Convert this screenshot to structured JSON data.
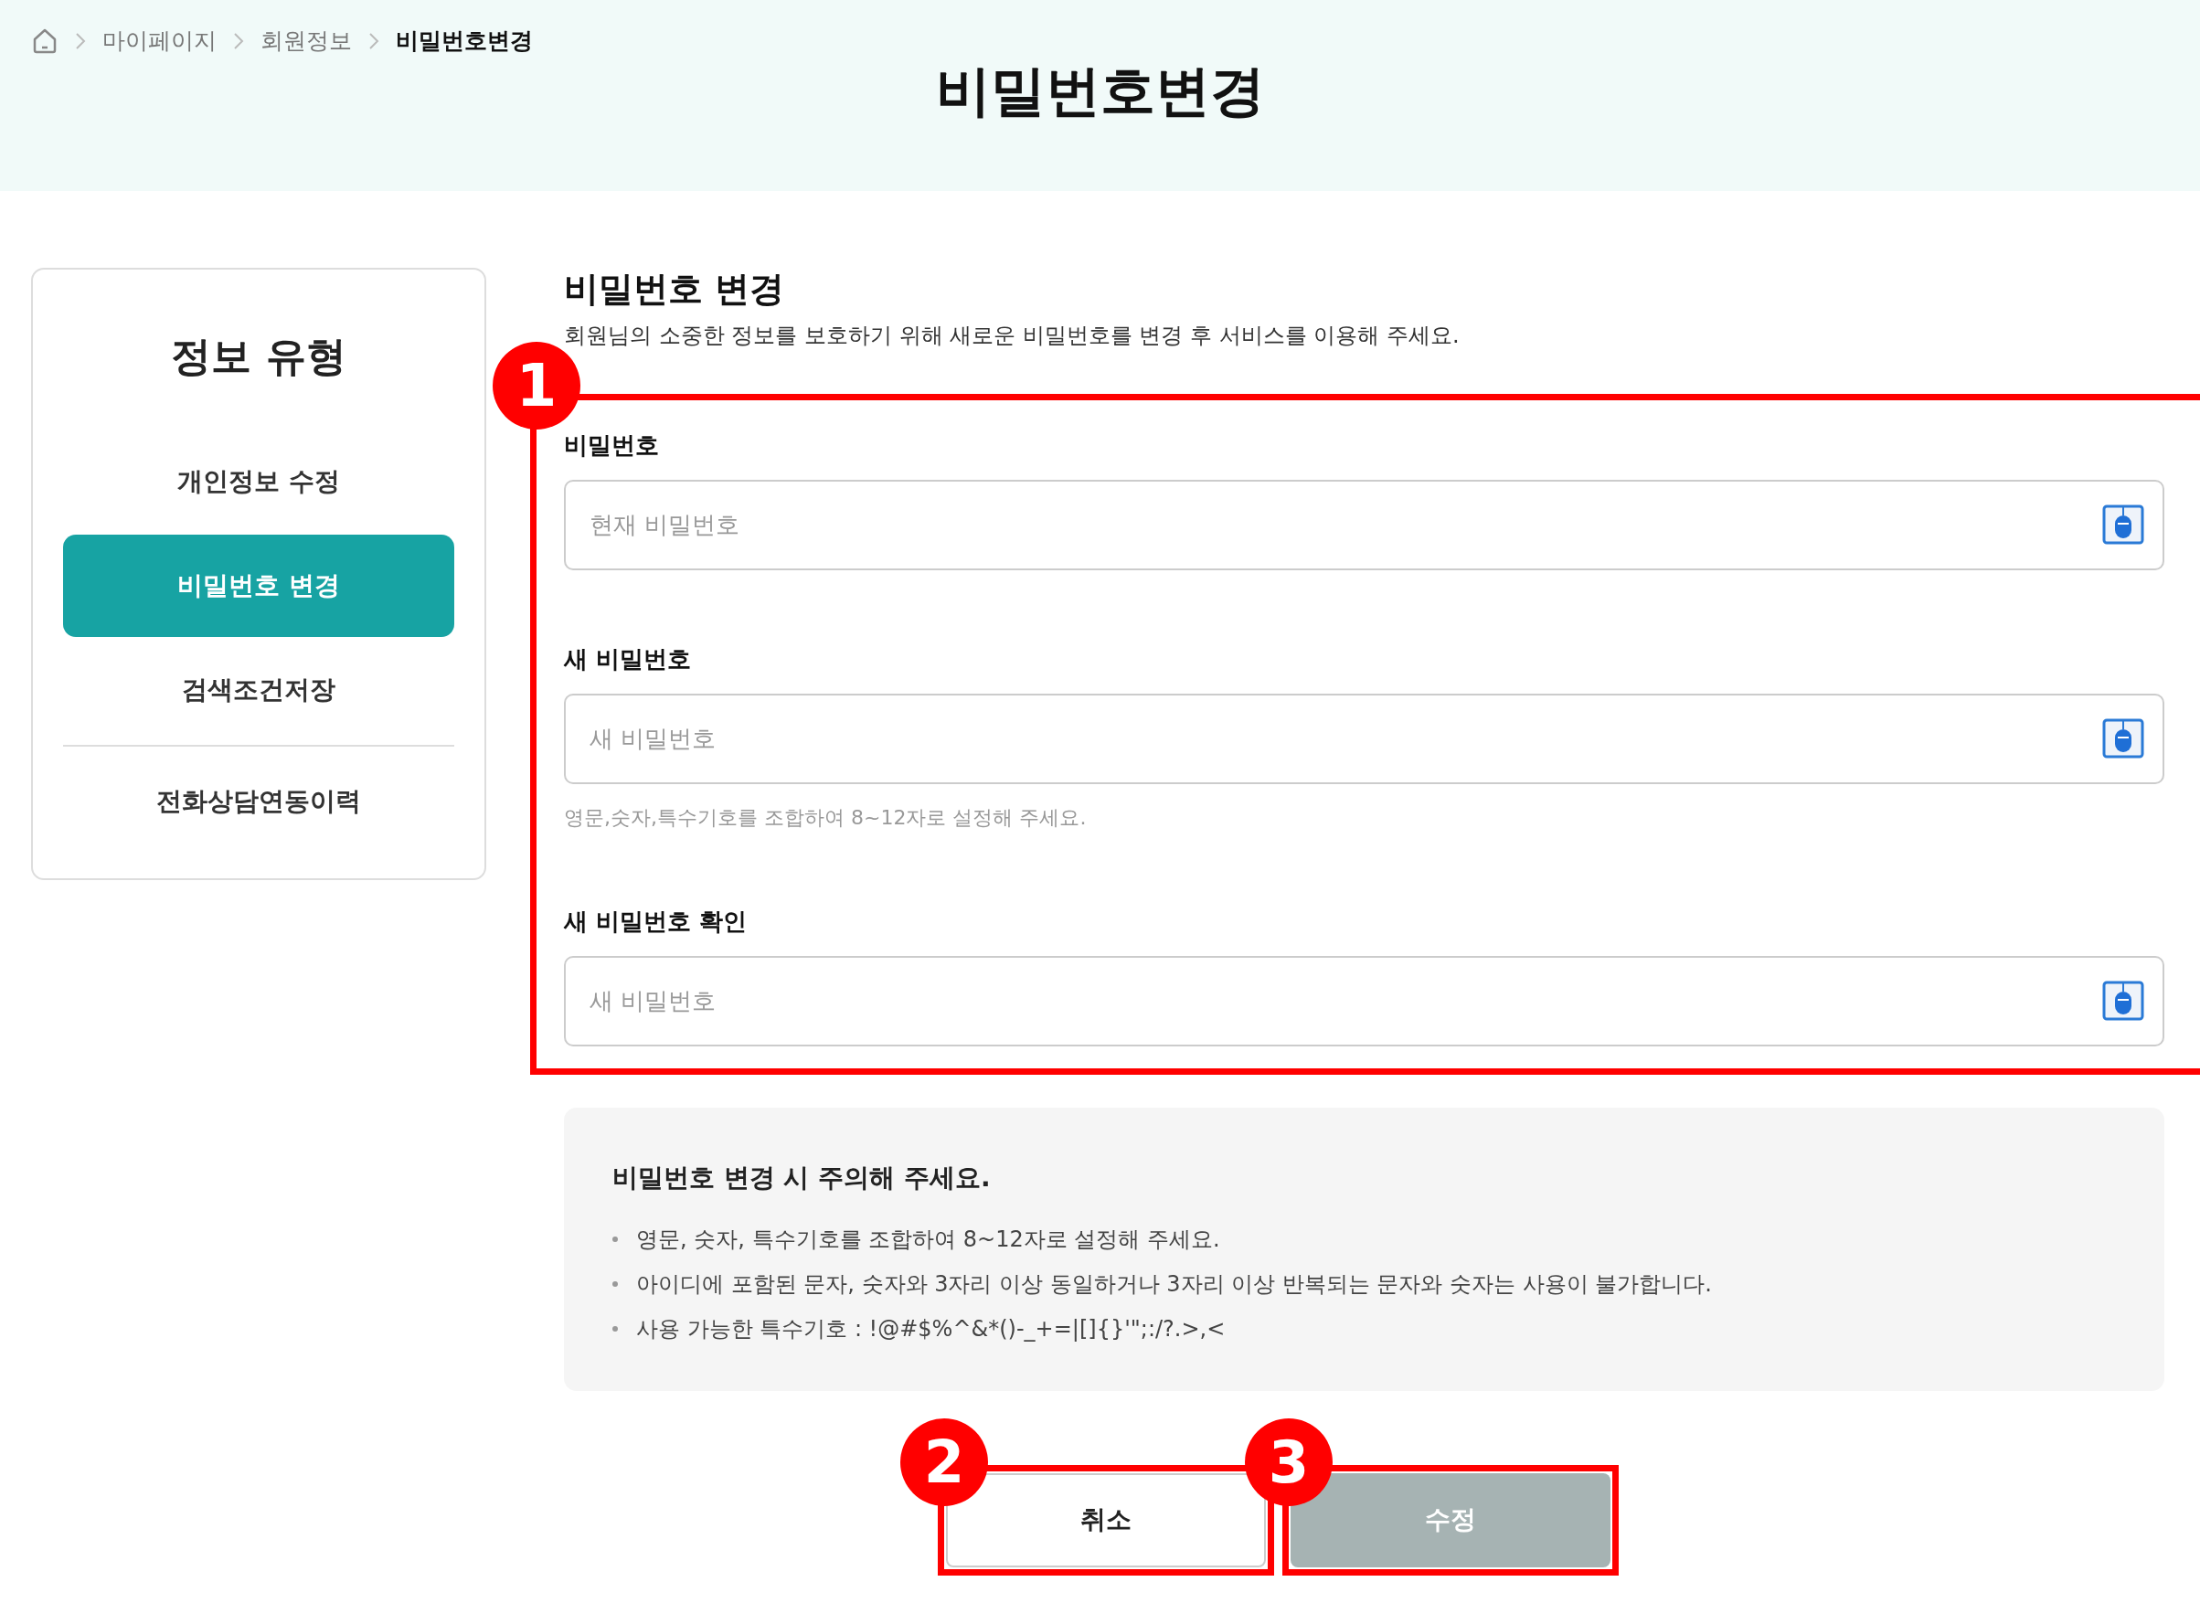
{
  "breadcrumb": [
    {
      "label": "마이페이지",
      "current": false
    },
    {
      "label": "회원정보",
      "current": false
    },
    {
      "label": "비밀번호변경",
      "current": true
    }
  ],
  "page_title": "비밀번호변경",
  "sidebar": {
    "title": "정보 유형",
    "items": [
      {
        "label": "개인정보 수정",
        "selected": false
      },
      {
        "label": "비밀번호 변경",
        "selected": true
      },
      {
        "label": "검색조건저장",
        "selected": false
      },
      {
        "label": "전화상담연동이력",
        "selected": false
      }
    ]
  },
  "section": {
    "title": "비밀번호 변경",
    "description": "회원님의 소중한 정보를 보호하기 위해 새로운 비밀번호를 변경 후 서비스를 이용해 주세요.",
    "callout": "1"
  },
  "fields": [
    {
      "label": "비밀번호",
      "placeholder": "현재 비밀번호"
    },
    {
      "label": "새 비밀번호",
      "placeholder": "새 비밀번호",
      "helper": "영문,숫자,특수기호를 조합하여 8~12자로 설정해 주세요."
    },
    {
      "label": "새 비밀번호 확인",
      "placeholder": "새 비밀번호"
    }
  ],
  "notice": {
    "title": "비밀번호 변경 시 주의해 주세요.",
    "bullets": [
      "영문, 숫자, 특수기호를 조합하여 8~12자로 설정해 주세요.",
      "아이디에 포함된 문자, 숫자와 3자리 이상 동일하거나 3자리 이상 반복되는 문자와 숫자는 사용이 불가합니다.",
      "사용 가능한 특수기호 : !@#$%^&*()-_+=|[]{}'\";:/?.>,<"
    ]
  },
  "buttons": [
    {
      "label": "취소",
      "kind": "secondary",
      "callout": "2"
    },
    {
      "label": "수정",
      "kind": "primary",
      "callout": "3"
    }
  ]
}
